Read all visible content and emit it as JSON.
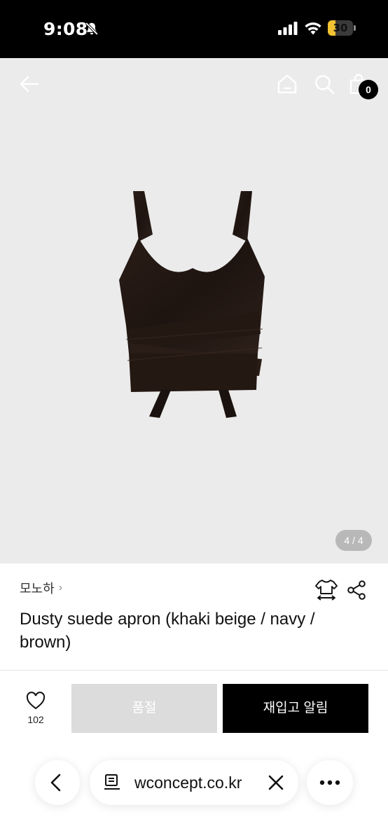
{
  "status_bar": {
    "time": "9:08",
    "battery": "30",
    "battery_percent": 30,
    "icons": [
      "bell-slash-icon",
      "cellular-signal-icon",
      "wifi-icon",
      "battery-icon"
    ]
  },
  "header": {
    "icons": [
      "arrow-left-icon",
      "home-icon",
      "search-icon",
      "shopping-bag-icon"
    ],
    "cart_count": "0"
  },
  "gallery": {
    "indicator": "4 / 4",
    "background": "#ebebeb"
  },
  "product": {
    "brand": "모노하",
    "brand_chevron": "›",
    "title": "Dusty suede apron (khaki beige / navy / brown)",
    "icons": [
      "size-guide-shirt-icon",
      "share-icon"
    ]
  },
  "actions": {
    "like_count": "102",
    "soldout_label": "품절",
    "restock_label": "재입고 알림"
  },
  "browser": {
    "url": "wconcept.co.kr",
    "icons": [
      "chevron-left-icon",
      "page-icon",
      "close-icon",
      "more-icon"
    ]
  }
}
